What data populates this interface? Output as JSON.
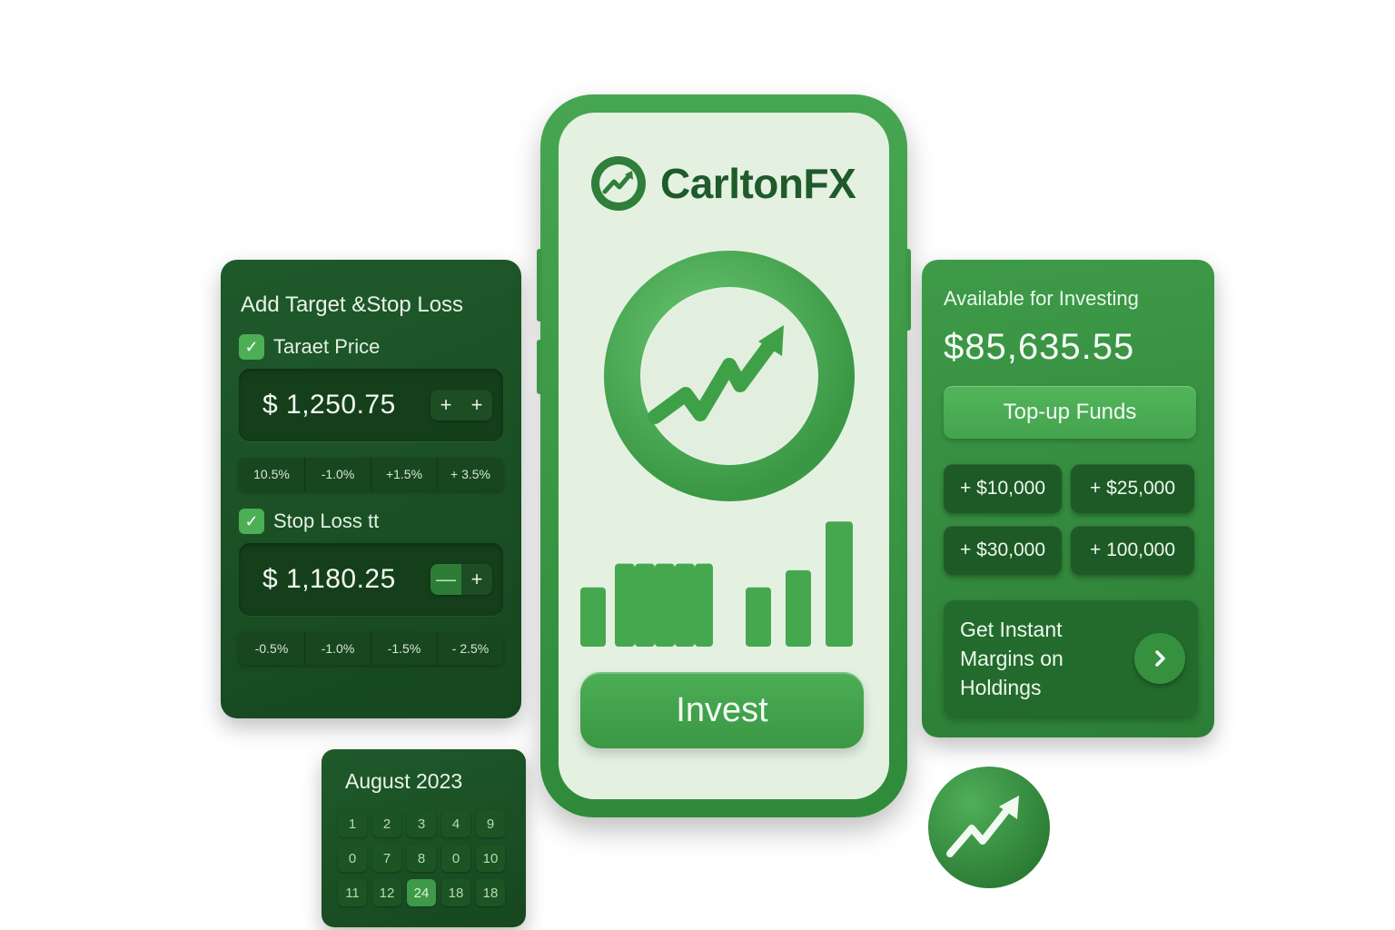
{
  "target_stop": {
    "title": "Add Target &Stop Loss",
    "target_label": "Taraet Price",
    "target_value": "$ 1,250.75",
    "target_minus": "+",
    "target_plus": "+",
    "target_pcts": [
      "10.5%",
      "-1.0%",
      "+1.5%",
      "+ 3.5%"
    ],
    "stop_label": "Stop Loss tt",
    "stop_value": "$ 1,180.25",
    "stop_minus": "—",
    "stop_plus": "+",
    "stop_pcts": [
      "-0.5%",
      "-1.0%",
      "-1.5%",
      "- 2.5%"
    ]
  },
  "calendar": {
    "title": "August 2023",
    "days": [
      "1",
      "2",
      "3",
      "4",
      "9",
      "0",
      "7",
      "8",
      "0",
      "10",
      "11",
      "12",
      "24",
      "18",
      "18"
    ],
    "selected_day": "24"
  },
  "phone": {
    "brand": "CarltonFX",
    "bar_levels": [
      0.45,
      0.63,
      0.63,
      0.63,
      0.63,
      0.63,
      0.45,
      0.58,
      0.95
    ],
    "invest_label": "Invest"
  },
  "funds": {
    "available_label": "Available for Investing",
    "available_amount": "$85,635.55",
    "topup_label": "Top-up Funds",
    "amounts": [
      "+ $10,000",
      "+ $25,000",
      "+ $30,000",
      "+ 100,000"
    ],
    "margin_text": "Get Instant Margins on Holdings"
  },
  "colors": {
    "brand_green": "#1f5a2b",
    "accent_green": "#45a34e",
    "screen_bg": "#e4f1e1"
  },
  "icons": {
    "logo": "trend-up-circle-icon",
    "hero": "trend-up-arrow-icon",
    "margin_arrow": "chevron-right-icon",
    "badge": "trend-up-arrow-icon",
    "check": "check-icon"
  }
}
